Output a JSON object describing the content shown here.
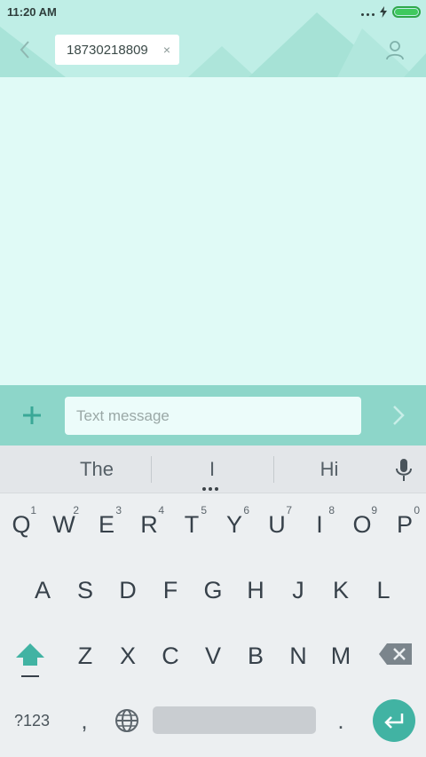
{
  "status_bar": {
    "time": "11:20 AM",
    "icons": [
      "more-dots-icon",
      "charging-bolt-icon",
      "battery-full-icon"
    ]
  },
  "header": {
    "back_icon": "chevron-left-icon",
    "recipient": "18730218809",
    "recipient_remove": "×",
    "contact_icon": "person-icon"
  },
  "compose": {
    "add_icon": "plus-icon",
    "placeholder": "Text message",
    "value": "",
    "send_icon": "chevron-right-icon"
  },
  "keyboard": {
    "suggestions": [
      "The",
      "I",
      "Hi"
    ],
    "mic_icon": "microphone-icon",
    "row1": [
      {
        "key": "Q",
        "hint": "1"
      },
      {
        "key": "W",
        "hint": "2"
      },
      {
        "key": "E",
        "hint": "3"
      },
      {
        "key": "R",
        "hint": "4"
      },
      {
        "key": "T",
        "hint": "5"
      },
      {
        "key": "Y",
        "hint": "6"
      },
      {
        "key": "U",
        "hint": "7"
      },
      {
        "key": "I",
        "hint": "8"
      },
      {
        "key": "O",
        "hint": "9"
      },
      {
        "key": "P",
        "hint": "0"
      }
    ],
    "row2": [
      "A",
      "S",
      "D",
      "F",
      "G",
      "H",
      "J",
      "K",
      "L"
    ],
    "row3": [
      "Z",
      "X",
      "C",
      "V",
      "B",
      "N",
      "M"
    ],
    "shift_icon": "shift-arrow-icon",
    "backspace_icon": "backspace-icon",
    "symbols_label": "?123",
    "comma_label": ",",
    "globe_icon": "globe-icon",
    "period_label": ".",
    "enter_icon": "enter-return-icon"
  },
  "colors": {
    "header_bg": "#bfeee6",
    "conversation_bg": "#e0faf6",
    "compose_bg": "#8dd6c9",
    "accent": "#41b3a3",
    "keyboard_bg": "#eceff1"
  }
}
